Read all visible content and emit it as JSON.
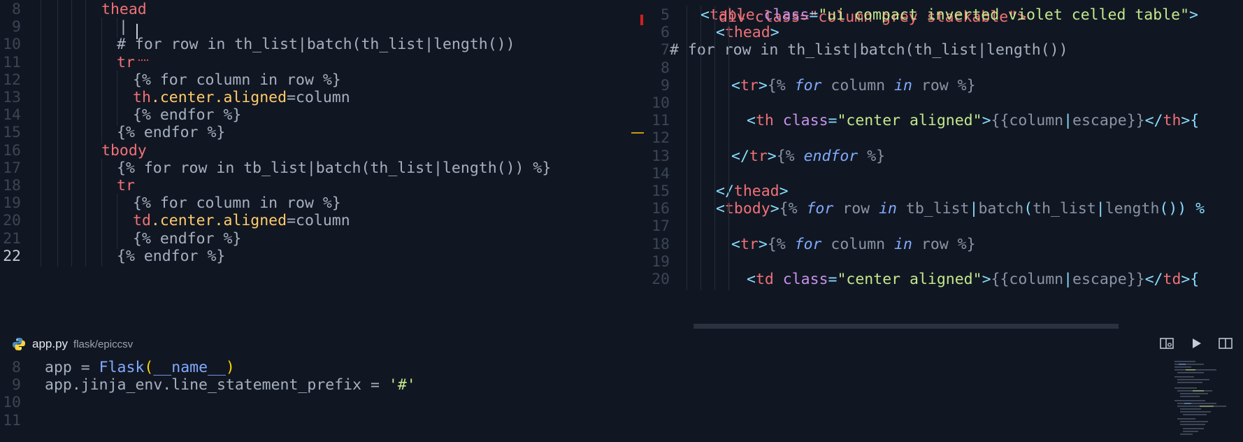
{
  "left": {
    "lines": [
      {
        "n": "8",
        "segs": [
          {
            "t": "thead",
            "c": "k-tag"
          }
        ]
      },
      {
        "n": "9",
        "segs": [
          {
            "t": "|",
            "c": "k-plain"
          }
        ]
      },
      {
        "n": "10",
        "segs": [
          {
            "t": "# for row in th_list|batch(th_list|length())",
            "c": "k-plain"
          }
        ]
      },
      {
        "n": "11",
        "segs": [
          {
            "t": "tr",
            "c": "k-tag"
          }
        ]
      },
      {
        "n": "12",
        "segs": [
          {
            "t": "{% for column in row %}",
            "c": "k-plain"
          }
        ]
      },
      {
        "n": "13",
        "segs": [
          {
            "t": "th",
            "c": "k-tag"
          },
          {
            "t": ".center",
            "c": "k-cls"
          },
          {
            "t": ".aligned",
            "c": "k-cls"
          },
          {
            "t": "=column",
            "c": "k-plain"
          }
        ]
      },
      {
        "n": "14",
        "segs": [
          {
            "t": "{% endfor %}",
            "c": "k-plain"
          }
        ]
      },
      {
        "n": "15",
        "segs": [
          {
            "t": "{% endfor %}",
            "c": "k-plain"
          }
        ]
      },
      {
        "n": "16",
        "segs": [
          {
            "t": "tbody",
            "c": "k-tag"
          }
        ]
      },
      {
        "n": "17",
        "segs": [
          {
            "t": "{% for row in tb_list|batch(th_list|length()) %}",
            "c": "k-plain"
          }
        ]
      },
      {
        "n": "18",
        "segs": [
          {
            "t": "tr",
            "c": "k-tag"
          }
        ]
      },
      {
        "n": "19",
        "segs": [
          {
            "t": "{% for column in row %}",
            "c": "k-plain"
          }
        ]
      },
      {
        "n": "20",
        "segs": [
          {
            "t": "td",
            "c": "k-tag"
          },
          {
            "t": ".center",
            "c": "k-cls"
          },
          {
            "t": ".aligned",
            "c": "k-cls"
          },
          {
            "t": "=column",
            "c": "k-plain"
          }
        ]
      },
      {
        "n": "21",
        "segs": [
          {
            "t": "{% endfor %}",
            "c": "k-plain"
          }
        ]
      },
      {
        "n": "22",
        "segs": [
          {
            "t": "{% endfor %}",
            "c": "k-plain"
          }
        ]
      }
    ]
  },
  "right": {
    "top_partial": "div class=\"column grey stackable\">",
    "lines": [
      {
        "n": "5",
        "segs": [
          {
            "t": "<",
            "c": "k-punc"
          },
          {
            "t": "table",
            "c": "k-tag"
          },
          {
            "t": " class",
            "c": "k-attr"
          },
          {
            "t": "=",
            "c": "k-punc"
          },
          {
            "t": "\"ui compact inverted violet celled table\"",
            "c": "k-str"
          },
          {
            "t": ">",
            "c": "k-punc"
          }
        ]
      },
      {
        "n": "6",
        "segs": [
          {
            "t": "<",
            "c": "k-punc"
          },
          {
            "t": "thead",
            "c": "k-tag"
          },
          {
            "t": ">",
            "c": "k-punc"
          }
        ]
      },
      {
        "n": "7",
        "segs": [
          {
            "t": "# for row in th_list|batch(th_list|length())",
            "c": "k-plain"
          }
        ]
      },
      {
        "n": "8",
        "segs": []
      },
      {
        "n": "9",
        "segs": [
          {
            "t": "<",
            "c": "k-punc"
          },
          {
            "t": "tr",
            "c": "k-tag"
          },
          {
            "t": ">",
            "c": "k-punc"
          },
          {
            "t": "{% ",
            "c": "k-muted"
          },
          {
            "t": "for",
            "c": "k-kw"
          },
          {
            "t": " column ",
            "c": "k-muted"
          },
          {
            "t": "in",
            "c": "k-kw"
          },
          {
            "t": " row %}",
            "c": "k-muted"
          }
        ]
      },
      {
        "n": "10",
        "segs": []
      },
      {
        "n": "11",
        "segs": [
          {
            "t": "<",
            "c": "k-punc"
          },
          {
            "t": "th",
            "c": "k-tag"
          },
          {
            "t": " class",
            "c": "k-attr"
          },
          {
            "t": "=",
            "c": "k-punc"
          },
          {
            "t": "\"center aligned\"",
            "c": "k-str"
          },
          {
            "t": ">",
            "c": "k-punc"
          },
          {
            "t": "{{column",
            "c": "k-muted"
          },
          {
            "t": "|",
            "c": "k-punc"
          },
          {
            "t": "escape}}",
            "c": "k-muted"
          },
          {
            "t": "</",
            "c": "k-punc"
          },
          {
            "t": "th",
            "c": "k-tag"
          },
          {
            "t": ">{",
            "c": "k-punc"
          }
        ]
      },
      {
        "n": "12",
        "segs": []
      },
      {
        "n": "13",
        "segs": [
          {
            "t": "</",
            "c": "k-punc"
          },
          {
            "t": "tr",
            "c": "k-tag"
          },
          {
            "t": ">",
            "c": "k-punc"
          },
          {
            "t": "{% ",
            "c": "k-muted"
          },
          {
            "t": "endfor",
            "c": "k-kw"
          },
          {
            "t": " %}",
            "c": "k-muted"
          }
        ]
      },
      {
        "n": "14",
        "segs": []
      },
      {
        "n": "15",
        "segs": [
          {
            "t": "</",
            "c": "k-punc"
          },
          {
            "t": "thead",
            "c": "k-tag"
          },
          {
            "t": ">",
            "c": "k-punc"
          }
        ]
      },
      {
        "n": "16",
        "segs": [
          {
            "t": "<",
            "c": "k-punc"
          },
          {
            "t": "tbody",
            "c": "k-tag"
          },
          {
            "t": ">",
            "c": "k-punc"
          },
          {
            "t": "{% ",
            "c": "k-muted"
          },
          {
            "t": "for",
            "c": "k-kw"
          },
          {
            "t": " row ",
            "c": "k-muted"
          },
          {
            "t": "in",
            "c": "k-kw"
          },
          {
            "t": " tb_list",
            "c": "k-muted"
          },
          {
            "t": "|",
            "c": "k-punc"
          },
          {
            "t": "batch",
            "c": "k-muted"
          },
          {
            "t": "(",
            "c": "k-punc"
          },
          {
            "t": "th_list",
            "c": "k-muted"
          },
          {
            "t": "|",
            "c": "k-punc"
          },
          {
            "t": "length",
            "c": "k-muted"
          },
          {
            "t": "()) %",
            "c": "k-punc"
          }
        ]
      },
      {
        "n": "17",
        "segs": []
      },
      {
        "n": "18",
        "segs": [
          {
            "t": "<",
            "c": "k-punc"
          },
          {
            "t": "tr",
            "c": "k-tag"
          },
          {
            "t": ">",
            "c": "k-punc"
          },
          {
            "t": "{% ",
            "c": "k-muted"
          },
          {
            "t": "for",
            "c": "k-kw"
          },
          {
            "t": " column ",
            "c": "k-muted"
          },
          {
            "t": "in",
            "c": "k-kw"
          },
          {
            "t": " row %}",
            "c": "k-muted"
          }
        ]
      },
      {
        "n": "19",
        "segs": []
      },
      {
        "n": "20",
        "segs": [
          {
            "t": "<",
            "c": "k-punc"
          },
          {
            "t": "td",
            "c": "k-tag"
          },
          {
            "t": " class",
            "c": "k-attr"
          },
          {
            "t": "=",
            "c": "k-punc"
          },
          {
            "t": "\"center aligned\"",
            "c": "k-str"
          },
          {
            "t": ">",
            "c": "k-punc"
          },
          {
            "t": "{{column",
            "c": "k-muted"
          },
          {
            "t": "|",
            "c": "k-punc"
          },
          {
            "t": "escape}}",
            "c": "k-muted"
          },
          {
            "t": "</",
            "c": "k-punc"
          },
          {
            "t": "td",
            "c": "k-tag"
          },
          {
            "t": ">{",
            "c": "k-punc"
          }
        ]
      }
    ]
  },
  "tab": {
    "filename": "app.py",
    "path": "flask/epiccsv",
    "icon": "python-icon"
  },
  "toolbar": {
    "split_preview_icon": "split-preview-icon",
    "run_icon": "play-icon",
    "split_editor_icon": "split-editor-icon"
  },
  "bottom": {
    "lines": [
      {
        "n": "8",
        "segs": [
          {
            "t": "app = ",
            "c": "k-plain"
          },
          {
            "t": "Flask",
            "c": "k-fn"
          },
          {
            "t": "(",
            "c": "k-paren"
          },
          {
            "t": "__name__",
            "c": "k-fn"
          },
          {
            "t": ")",
            "c": "k-paren"
          }
        ]
      },
      {
        "n": "9",
        "segs": [
          {
            "t": "app.jinja_env.line_statement_prefix = ",
            "c": "k-plain"
          },
          {
            "t": "'#'",
            "c": "k-str"
          }
        ]
      },
      {
        "n": "10",
        "segs": []
      },
      {
        "n": "11",
        "segs": []
      }
    ]
  }
}
